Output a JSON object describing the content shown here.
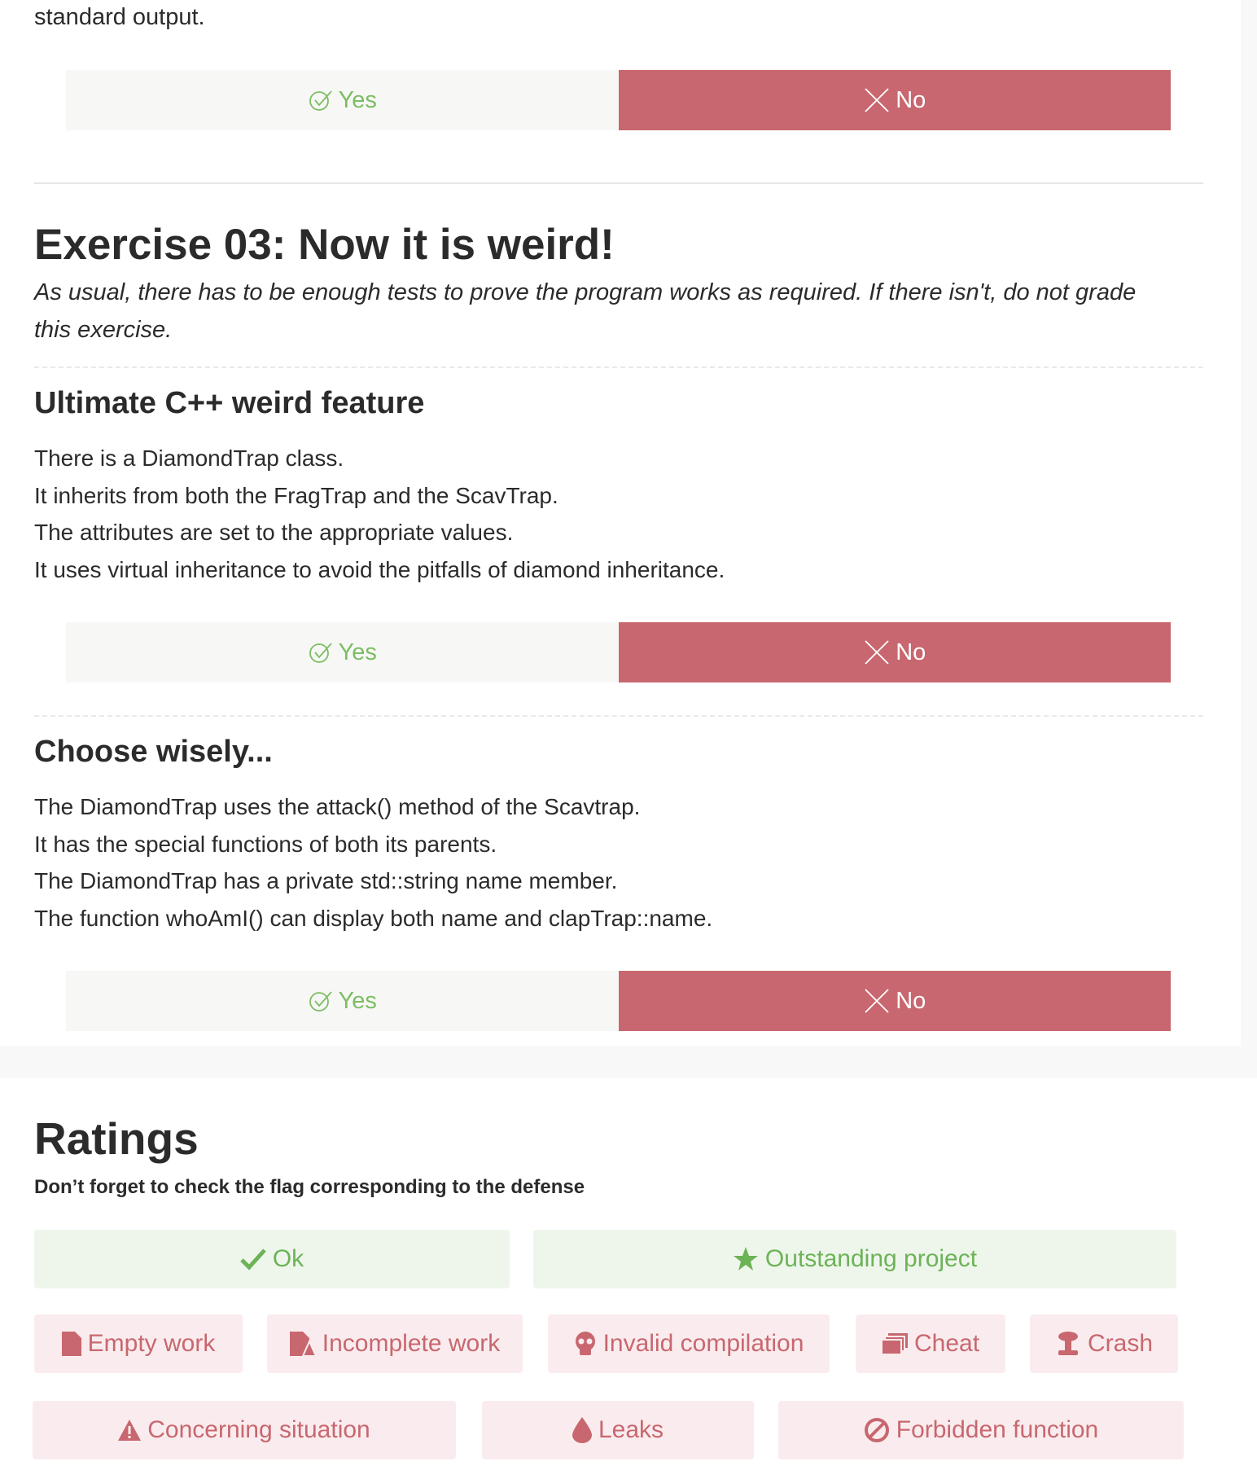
{
  "top_text": "standard output.",
  "buttons": {
    "yes_label": "Yes",
    "no_label": "No"
  },
  "exercise": {
    "title": "Exercise 03: Now it is weird!",
    "description": "As usual, there has to be enough tests to prove the program works as required. If there isn't, do not grade this exercise."
  },
  "sections": [
    {
      "title": "Ultimate C++ weird feature",
      "lines": [
        "There is a DiamondTrap class.",
        "It inherits from both the FragTrap and the ScavTrap.",
        "The attributes are set to the appropriate values.",
        "It uses virtual inheritance to avoid the pitfalls of diamond inheritance."
      ]
    },
    {
      "title": "Choose wisely...",
      "lines": [
        "The DiamondTrap uses the attack() method of the Scavtrap.",
        "It has the special functions of both its parents.",
        "The DiamondTrap has a private std::string name member.",
        "The function whoAmI() can display both name and clapTrap::name."
      ]
    }
  ],
  "ratings": {
    "title": "Ratings",
    "subtitle": "Don’t forget to check the flag corresponding to the defense",
    "flags": {
      "ok": "Ok",
      "outstanding": "Outstanding project",
      "empty": "Empty work",
      "incomplete": "Incomplete work",
      "invalid": "Invalid compilation",
      "cheat": "Cheat",
      "crash": "Crash",
      "concerning": "Concerning situation",
      "leaks": "Leaks",
      "forbidden": "Forbidden function"
    }
  },
  "colors": {
    "yes_text": "#7cbd62",
    "no_background": "#c8676f",
    "good_flag_bg": "#eef6ec",
    "bad_flag_bg": "#faecee"
  },
  "icons": {
    "yes": "check-circle-icon",
    "no": "x-icon",
    "ok": "checkmark-icon",
    "outstanding": "star-icon",
    "empty": "file-icon",
    "incomplete": "file-warning-icon",
    "invalid": "skull-icon",
    "cheat": "copy-icon",
    "crash": "explosion-icon",
    "concerning": "warning-icon",
    "leaks": "drop-icon",
    "forbidden": "ban-icon"
  }
}
